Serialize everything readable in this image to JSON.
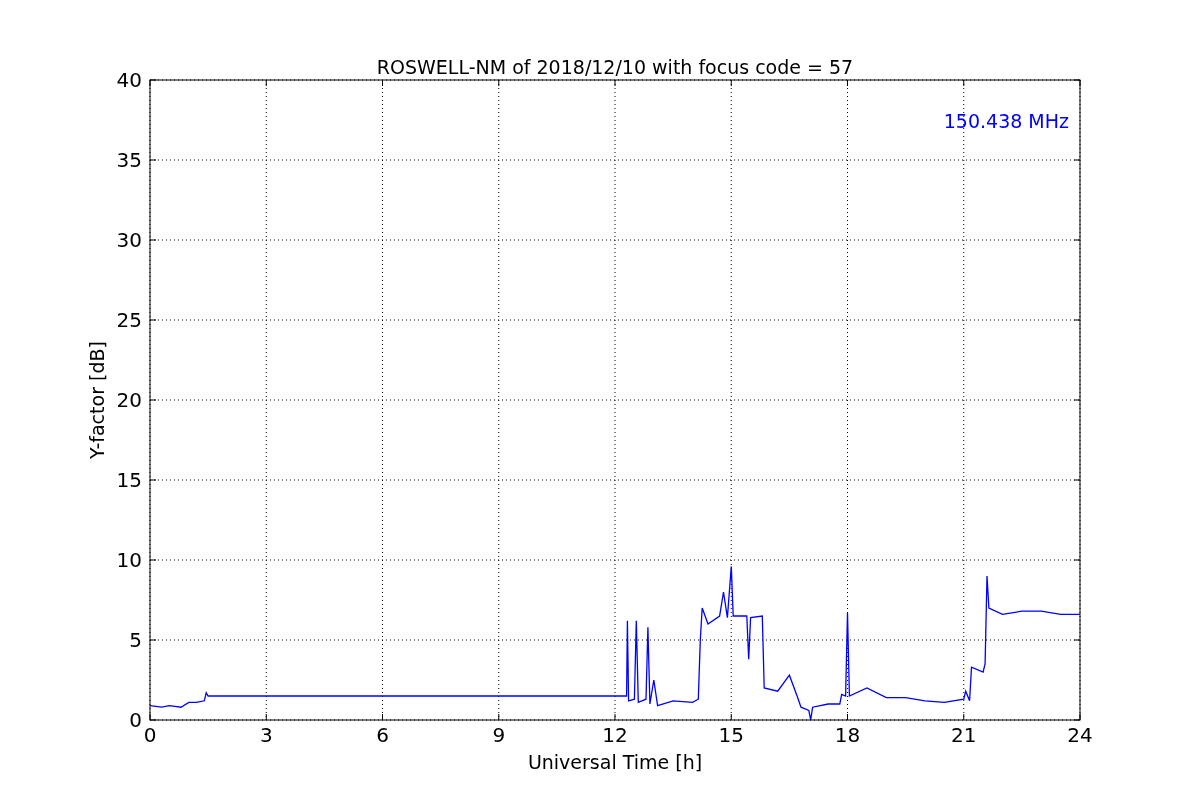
{
  "figure": {
    "chart_data": {
      "type": "line",
      "title": "ROSWELL-NM of 2018/12/10 with focus code = 57",
      "xlabel": "Universal Time [h]",
      "ylabel": "Y-factor [dB]",
      "xlim": [
        0,
        24
      ],
      "ylim": [
        0,
        40
      ],
      "xticks": [
        0,
        3,
        6,
        9,
        12,
        15,
        18,
        21,
        24
      ],
      "yticks": [
        0,
        5,
        10,
        15,
        20,
        25,
        30,
        35,
        40
      ],
      "x": [
        0,
        0.3,
        0.5,
        0.8,
        1.0,
        1.2,
        1.4,
        1.45,
        1.5,
        12.3,
        12.32,
        12.35,
        12.5,
        12.55,
        12.6,
        12.8,
        12.85,
        12.9,
        13.0,
        13.1,
        13.5,
        14.0,
        14.15,
        14.2,
        14.25,
        14.4,
        14.7,
        14.8,
        14.9,
        15.0,
        15.05,
        15.4,
        15.45,
        15.5,
        15.8,
        15.85,
        16.2,
        16.5,
        16.7,
        16.8,
        17.0,
        17.05,
        17.1,
        17.5,
        17.8,
        17.85,
        17.95,
        18.0,
        18.05,
        18.5,
        19.0,
        19.5,
        20.0,
        20.5,
        21.0,
        21.05,
        21.15,
        21.2,
        21.5,
        21.55,
        21.6,
        21.65,
        22.0,
        22.5,
        23.0,
        23.5,
        24
      ],
      "series": [
        {
          "color": "#0000ff",
          "values": [
            0.9,
            0.8,
            0.9,
            0.8,
            1.1,
            1.1,
            1.2,
            1.7,
            1.5,
            1.5,
            6.2,
            1.2,
            1.3,
            6.2,
            1.1,
            1.3,
            5.8,
            1.0,
            2.5,
            0.9,
            1.2,
            1.1,
            1.3,
            5.0,
            7.0,
            6.0,
            6.5,
            8.0,
            6.4,
            9.6,
            6.5,
            6.5,
            3.8,
            6.4,
            6.5,
            2.0,
            1.8,
            2.8,
            1.5,
            0.8,
            0.6,
            0.0,
            0.8,
            1.0,
            1.0,
            1.6,
            1.5,
            6.7,
            1.5,
            2.0,
            1.4,
            1.4,
            1.2,
            1.1,
            1.3,
            1.8,
            1.2,
            3.3,
            3.0,
            3.5,
            9.0,
            7.0,
            6.6,
            6.8,
            6.8,
            6.6,
            6.6
          ]
        }
      ],
      "grid": true,
      "annotations": [
        {
          "text": "150.438 MHz"
        }
      ]
    }
  }
}
